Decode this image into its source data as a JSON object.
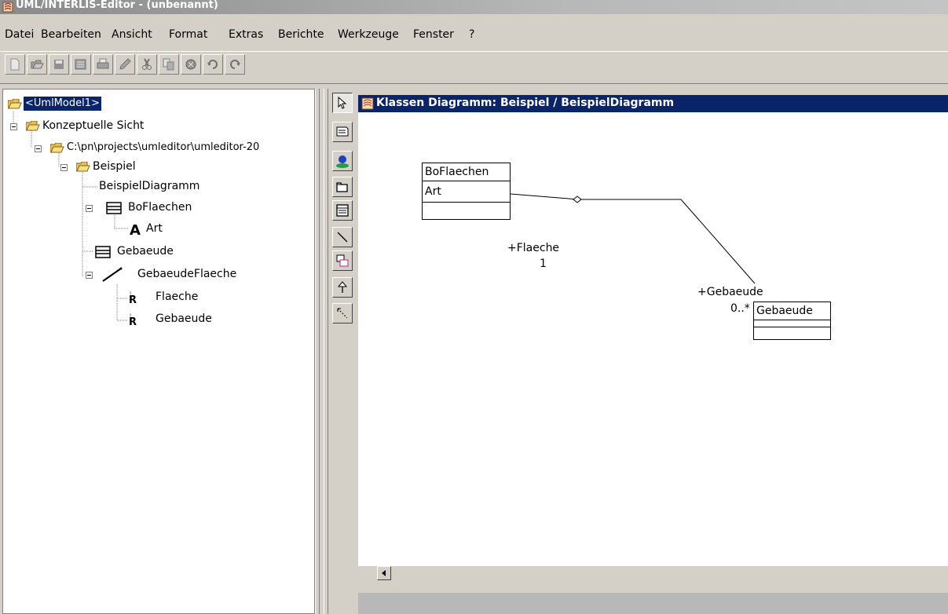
{
  "window": {
    "title": "UML/INTERLIS-Editor - (unbenannt)"
  },
  "menu": {
    "items": [
      "Datei",
      "Bearbeiten",
      "Ansicht",
      "Format",
      "Extras",
      "Berichte",
      "Werkzeuge",
      "Fenster",
      "?"
    ]
  },
  "toolbar": {
    "buttons": [
      "new-file-icon",
      "open-folder-icon",
      "save-icon",
      "save-as-icon",
      "print-icon",
      "edit-pencil-icon",
      "cut-icon",
      "copy-icon",
      "delete-icon",
      "undo-icon",
      "redo-icon"
    ]
  },
  "tree": {
    "root": "<UmlModel1>",
    "view": "Konzeptuelle Sicht",
    "path": "C:\\pn\\projects\\umleditor\\umleditor-20",
    "package": "Beispiel",
    "diagram": "BeispielDiagramm",
    "class1": "BoFlaechen",
    "attr1": "Art",
    "class2": "Gebaeude",
    "association": "GebaeudeFlaeche",
    "role1": "Flaeche",
    "role2": "Gebaeude"
  },
  "palette": {
    "tools": [
      "select-arrow-icon",
      "note-icon",
      "actor-icon",
      "package-icon",
      "class-icon",
      "association-line-icon",
      "linked-box-icon",
      "generalization-arrow-icon",
      "dependency-icon"
    ]
  },
  "diagram_window": {
    "title": "Klassen Diagramm: Beispiel / BeispielDiagramm"
  },
  "uml": {
    "class_bo": {
      "name": "BoFlaechen",
      "attr": "Art"
    },
    "class_geb": {
      "name": "Gebaeude"
    },
    "role_flaeche": {
      "label": "+Flaeche",
      "mult": "1"
    },
    "role_gebaeude": {
      "label": "+Gebaeude",
      "mult": "0..*"
    }
  }
}
